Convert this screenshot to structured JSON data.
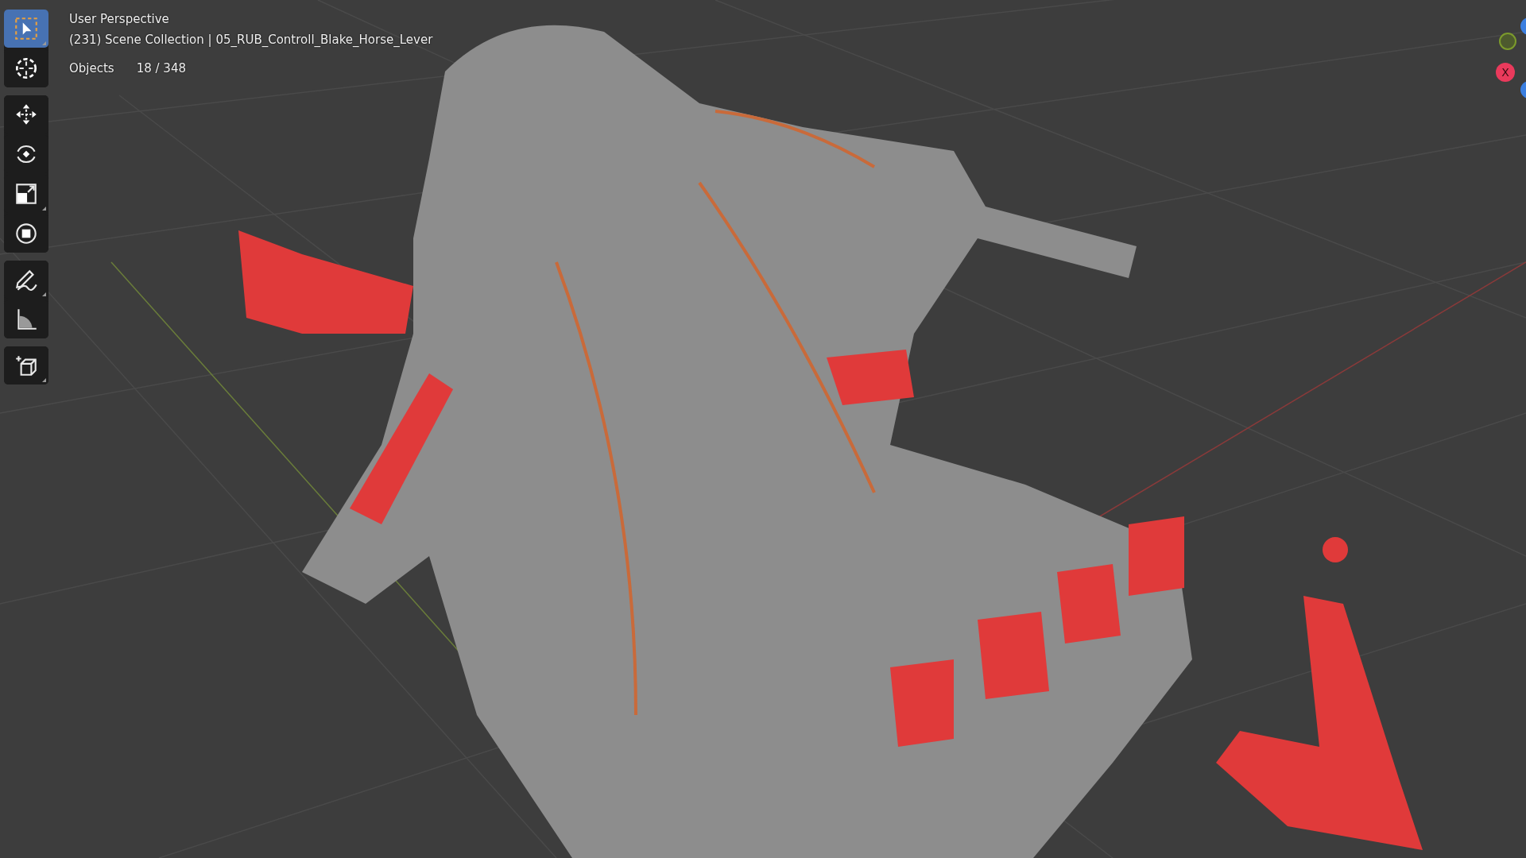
{
  "viewport": {
    "view_name": "User Perspective",
    "collection_line": "(231) Scene Collection | 05_RUB_Controll_Blake_Horse_Lever",
    "stats": [
      {
        "label": "Objects",
        "value": "18 / 348"
      }
    ]
  },
  "toolbar": {
    "groups": [
      [
        {
          "kind": "select",
          "selected": true,
          "submenu": true
        },
        {
          "kind": "cursor",
          "selected": false,
          "submenu": false
        }
      ],
      [
        {
          "kind": "move",
          "selected": false,
          "submenu": false
        },
        {
          "kind": "rotate",
          "selected": false,
          "submenu": false
        },
        {
          "kind": "scale",
          "selected": false,
          "submenu": true
        },
        {
          "kind": "transform",
          "selected": false,
          "submenu": false
        }
      ],
      [
        {
          "kind": "annotate",
          "selected": false,
          "submenu": true
        },
        {
          "kind": "measure",
          "selected": false,
          "submenu": false
        }
      ],
      [
        {
          "kind": "add-cube",
          "selected": false,
          "submenu": true
        }
      ]
    ]
  },
  "gizmo": {
    "x_label": "X"
  }
}
